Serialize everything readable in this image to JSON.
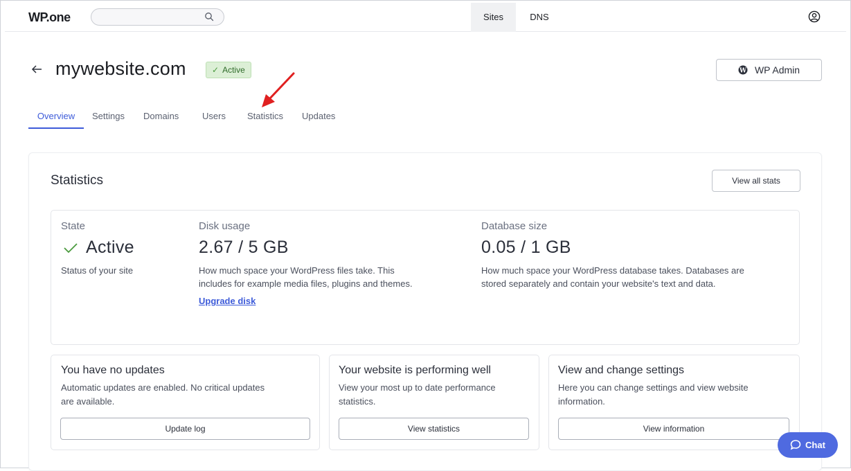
{
  "app": {
    "logo": "WP.one"
  },
  "topbar": {
    "search_placeholder": "",
    "nav": [
      {
        "label": "Sites",
        "active": true
      },
      {
        "label": "DNS",
        "active": false
      }
    ]
  },
  "header": {
    "site_name": "mywebsite.com",
    "status_badge": "Active",
    "wp_admin_label": "WP Admin"
  },
  "tabs": [
    {
      "label": "Overview",
      "active": true
    },
    {
      "label": "Settings",
      "active": false
    },
    {
      "label": "Domains",
      "active": false
    },
    {
      "label": "Users",
      "active": false
    },
    {
      "label": "Statistics",
      "active": false
    },
    {
      "label": "Updates",
      "active": false
    }
  ],
  "statistics": {
    "title": "Statistics",
    "view_all_label": "View all stats",
    "state": {
      "label": "State",
      "value": "Active",
      "desc": "Status of your site"
    },
    "disk": {
      "label": "Disk usage",
      "value": "2.67 / 5 GB",
      "desc_line1": "How much space your WordPress files take. This",
      "desc_line2": "includes for example media files, plugins and themes.",
      "link": "Upgrade disk"
    },
    "database": {
      "label": "Database size",
      "value": "0.05 / 1 GB",
      "desc_line1": "How much space your WordPress database takes. Databases are",
      "desc_line2": "stored separately and contain your website's text and data."
    }
  },
  "cards": [
    {
      "title": "You have no updates",
      "desc_line1": "Automatic updates are enabled. No critical updates",
      "desc_line2": "are available.",
      "button": "Update log"
    },
    {
      "title": "Your website is performing well",
      "desc_line1": "View your most up to date performance",
      "desc_line2": "statistics.",
      "button": "View statistics"
    },
    {
      "title": "View and change settings",
      "desc_line1": "Here you can change settings and view website",
      "desc_line2": "information.",
      "button": "View information"
    }
  ],
  "chat": {
    "label": "Chat"
  },
  "colors": {
    "accent": "#3d5bd9",
    "chat_bg": "#4f6ae0",
    "badge_bg": "#dcefd6",
    "annotation_arrow": "#e02020"
  },
  "icons": {
    "search": "search-icon",
    "user": "user-icon",
    "back": "back-arrow-icon",
    "wordpress": "wordpress-icon",
    "check": "check-icon",
    "chat": "chat-bubble-icon",
    "annotation": "red-arrow-annotation"
  }
}
